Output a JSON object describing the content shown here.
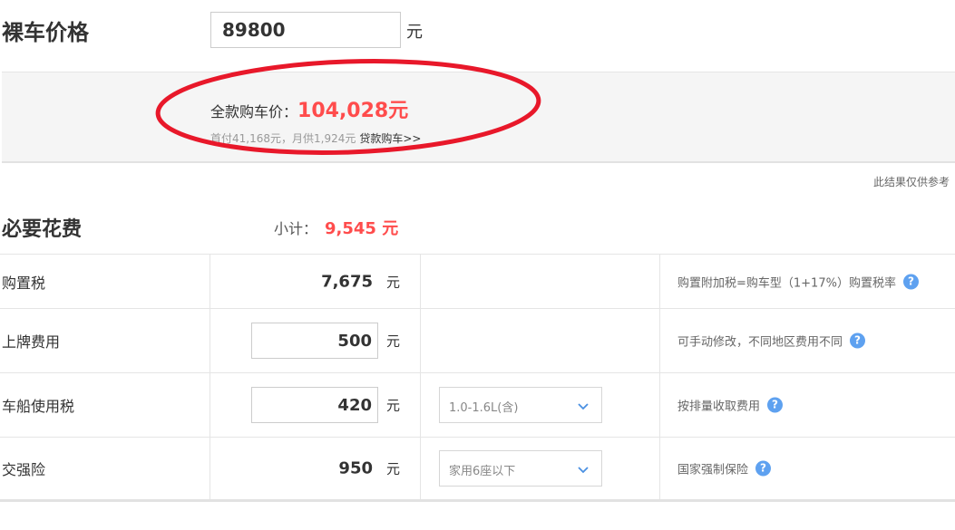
{
  "price": {
    "title": "裸车价格",
    "value": "89800",
    "unit": "元"
  },
  "summary": {
    "label": "全款购车价：",
    "total": "104,028元",
    "detail": "首付41,168元，月供1,924元",
    "loan_link": "贷款购车>>"
  },
  "disclaimer": "此结果仅供参考",
  "section": {
    "title": "必要花费",
    "subtotal_label": "小计：",
    "subtotal_value": "9,545 元"
  },
  "fees": [
    {
      "label": "购置税",
      "value": "7,675",
      "unit": "元",
      "note": "购置附加税=购车型（1+17%）购置税率"
    },
    {
      "label": "上牌费用",
      "value": "500",
      "unit": "元",
      "note": "可手动修改，不同地区费用不同"
    },
    {
      "label": "车船使用税",
      "value": "420",
      "unit": "元",
      "select": "1.0-1.6L(含)",
      "note": "按排量收取费用"
    },
    {
      "label": "交强险",
      "value": "950",
      "unit": "元",
      "select": "家用6座以下",
      "note": "国家强制保险"
    }
  ],
  "help_glyph": "?",
  "colors": {
    "accent_red": "#ff4c4c",
    "help_blue": "#5ea1f0",
    "annotation_red": "#e8182a"
  }
}
